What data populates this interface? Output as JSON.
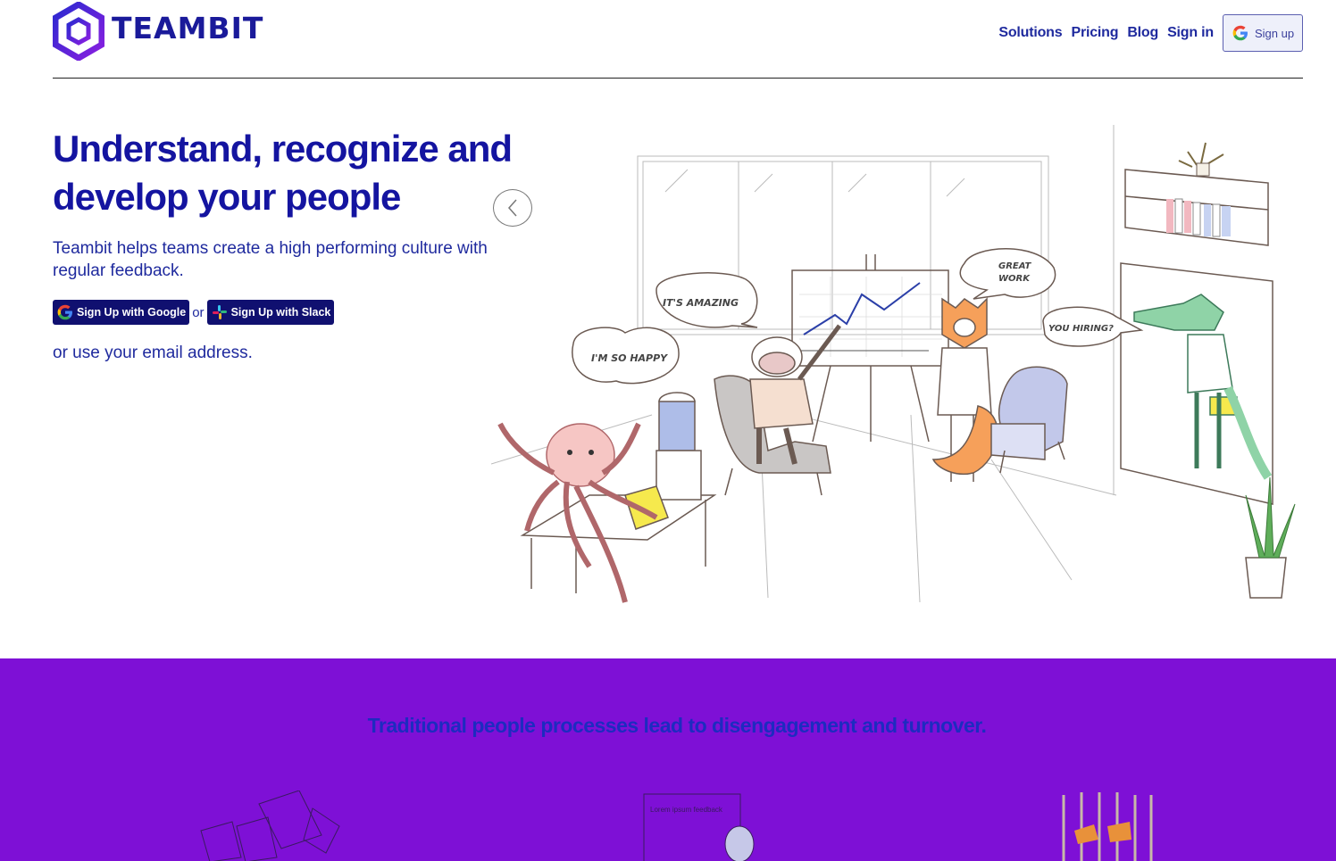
{
  "header": {
    "logo_text": "TEAMBIT",
    "nav": [
      "Solutions",
      "Pricing",
      "Blog",
      "Sign in"
    ],
    "signup_label": "Sign up"
  },
  "hero": {
    "title": "Understand, recognize and develop your people",
    "subtitle": "Teambit helps teams create a high performing culture with regular feedback.",
    "google_button": "Sign Up with Google",
    "or_text": "or",
    "slack_button": "Sign Up with Slack",
    "email_text": "or use your email address."
  },
  "illustration": {
    "bubbles": [
      "I'M SO HAPPY",
      "IT'S AMAZING",
      "GREAT WORK",
      "YOU HIRING?"
    ]
  },
  "section2": {
    "heading": "Traditional people processes lead to disengagement and turnover.",
    "thumb2_caption": "Lorem ipsum feedback"
  },
  "colors": {
    "brand": "#1414a0",
    "purple_band": "#7e10d6",
    "button_dark": "#101070"
  }
}
